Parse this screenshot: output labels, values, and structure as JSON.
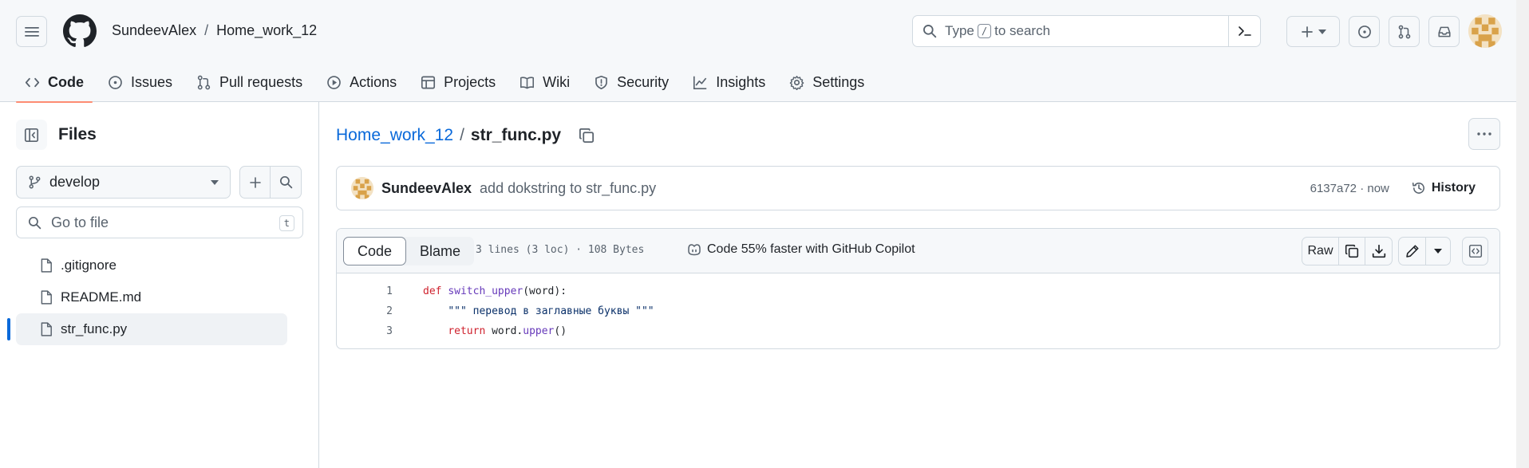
{
  "header": {
    "owner": "SundeevAlex",
    "separator": "/",
    "repo": "Home_work_12",
    "search_prefix": "Type",
    "search_key": "/",
    "search_suffix": "to search"
  },
  "tabs": [
    {
      "label": "Code",
      "icon": "code-icon",
      "active": true
    },
    {
      "label": "Issues",
      "icon": "issue-opened-icon"
    },
    {
      "label": "Pull requests",
      "icon": "git-pull-request-icon"
    },
    {
      "label": "Actions",
      "icon": "play-icon"
    },
    {
      "label": "Projects",
      "icon": "table-icon"
    },
    {
      "label": "Wiki",
      "icon": "book-icon"
    },
    {
      "label": "Security",
      "icon": "shield-icon"
    },
    {
      "label": "Insights",
      "icon": "graph-icon"
    },
    {
      "label": "Settings",
      "icon": "gear-icon"
    }
  ],
  "sidebar": {
    "title": "Files",
    "branch": "develop",
    "goto_placeholder": "Go to file",
    "goto_key": "t",
    "files": [
      {
        "name": ".gitignore"
      },
      {
        "name": "README.md"
      },
      {
        "name": "str_func.py",
        "selected": true
      }
    ]
  },
  "breadcrumb": {
    "repo": "Home_work_12",
    "separator": "/",
    "file": "str_func.py"
  },
  "commit": {
    "author": "SundeevAlex",
    "message": "add dokstring to str_func.py",
    "meta": "6137a72 · now",
    "history_label": "History"
  },
  "file": {
    "view_tabs": [
      "Code",
      "Blame"
    ],
    "info": "3 lines (3 loc) · 108 Bytes",
    "copilot": "Code 55% faster with GitHub Copilot",
    "raw_label": "Raw",
    "lines": [
      {
        "n": "1",
        "kw": "def",
        "fn": "switch_upper",
        "rest": "(word):"
      },
      {
        "n": "2",
        "indent": "    ",
        "str": "\"\"\" перевод в заглавные буквы \"\"\""
      },
      {
        "n": "3",
        "indent": "    ",
        "kw": "return",
        "plain": " word.",
        "fn": "upper",
        "rest": "()"
      }
    ]
  },
  "colors": {
    "link": "#0969da",
    "active_tab_underline": "#fd8c73",
    "keyword": "#cf222e",
    "function": "#6639ba",
    "string": "#0a3069"
  }
}
